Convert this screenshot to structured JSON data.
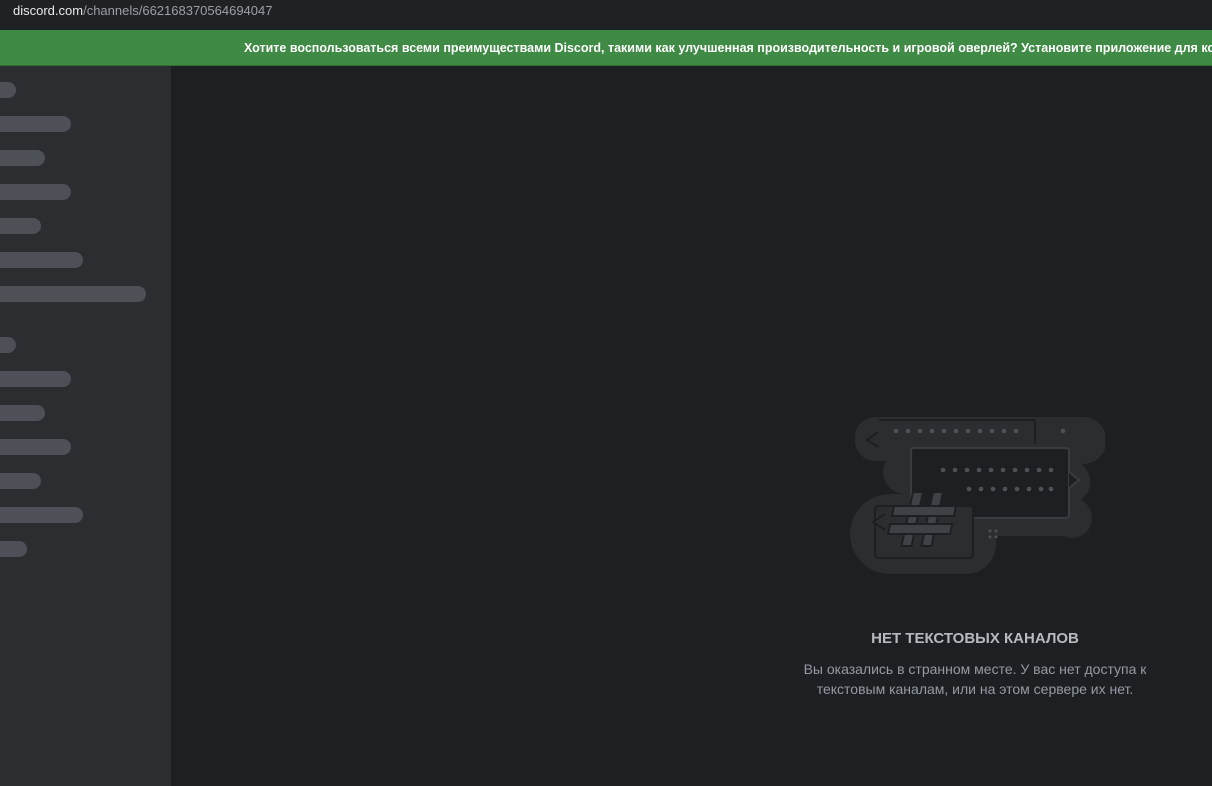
{
  "browser": {
    "url_host": "discord.com",
    "url_path": "/channels/662168370564694047"
  },
  "notice": {
    "text": "Хотите воспользоваться всеми преимуществами Discord, такими как улучшенная производительность и игровой оверлей? Установите приложение для компьютера!"
  },
  "sidebar": {
    "loading_placeholder_count": 14
  },
  "empty_state": {
    "title": "НЕТ ТЕКСТОВЫХ КАНАЛОВ",
    "description": "Вы оказались в странном месте. У вас нет доступа к текстовым каналам, или на этом сервере их нет.",
    "illustration_icon": "hash-chat-bubbles-icon"
  },
  "colors": {
    "notice_bg": "#3f8a44",
    "sidebar_bg": "#2b2d31",
    "main_bg": "#1e1f22",
    "placeholder": "#4e5058"
  }
}
